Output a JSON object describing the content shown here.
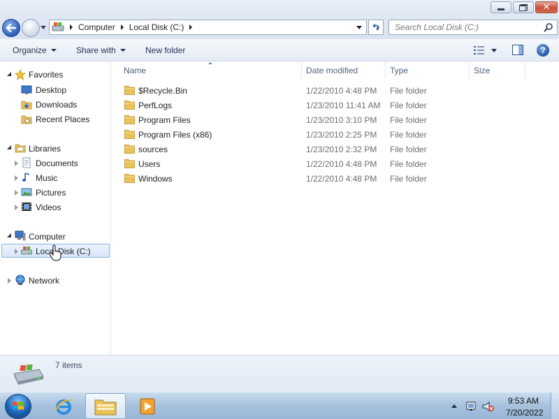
{
  "window": {
    "title_buttons": [
      "minimize",
      "maximize",
      "close"
    ],
    "close_glyph": "✕"
  },
  "address": {
    "breadcrumbs": [
      "Computer",
      "Local Disk (C:)"
    ],
    "search_placeholder": "Search Local Disk (C:)"
  },
  "toolbar": {
    "organize_label": "Organize",
    "share_label": "Share with",
    "new_folder_label": "New folder",
    "help_glyph": "?"
  },
  "nav": {
    "favorites": {
      "label": "Favorites",
      "items": [
        "Desktop",
        "Downloads",
        "Recent Places"
      ]
    },
    "libraries": {
      "label": "Libraries",
      "items": [
        "Documents",
        "Music",
        "Pictures",
        "Videos"
      ]
    },
    "computer": {
      "label": "Computer",
      "items": [
        "Local Disk (C:)"
      ]
    },
    "network": {
      "label": "Network"
    }
  },
  "columns": {
    "name": "Name",
    "date": "Date modified",
    "type": "Type",
    "size": "Size"
  },
  "files": [
    {
      "name": "$Recycle.Bin",
      "date": "1/22/2010 4:48 PM",
      "type": "File folder"
    },
    {
      "name": "PerfLogs",
      "date": "1/23/2010 11:41 AM",
      "type": "File folder"
    },
    {
      "name": "Program Files",
      "date": "1/23/2010 3:10 PM",
      "type": "File folder"
    },
    {
      "name": "Program Files (x86)",
      "date": "1/23/2010 2:25 PM",
      "type": "File folder"
    },
    {
      "name": "sources",
      "date": "1/23/2010 2:32 PM",
      "type": "File folder"
    },
    {
      "name": "Users",
      "date": "1/22/2010 4:48 PM",
      "type": "File folder"
    },
    {
      "name": "Windows",
      "date": "1/22/2010 4:48 PM",
      "type": "File folder"
    }
  ],
  "details": {
    "item_count": "7 items"
  },
  "taskbar": {
    "pinned": [
      "internet-explorer",
      "windows-explorer",
      "media-player"
    ],
    "time": "9:53 AM",
    "date": "7/20/2022"
  },
  "colors": {
    "accent": "#2b5db5",
    "selection_border": "#8db2e3",
    "folder": "#e8c35a"
  }
}
